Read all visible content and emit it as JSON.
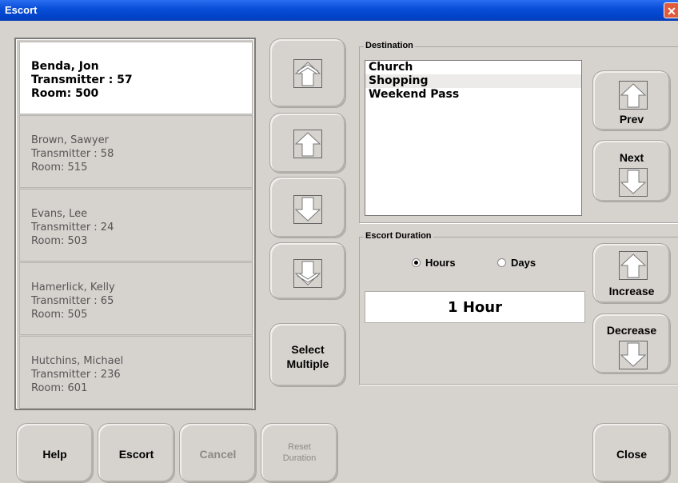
{
  "window": {
    "title": "Escort",
    "close_glyph": "✕"
  },
  "residents": [
    {
      "name": "Benda, Jon",
      "transmitter": "Transmitter : 57",
      "room": "Room: 500",
      "selected": true
    },
    {
      "name": "Brown, Sawyer",
      "transmitter": "Transmitter : 58",
      "room": "Room: 515",
      "selected": false
    },
    {
      "name": "Evans, Lee",
      "transmitter": "Transmitter : 24",
      "room": "Room: 503",
      "selected": false
    },
    {
      "name": "Hamerlick, Kelly",
      "transmitter": "Transmitter : 65",
      "room": "Room: 505",
      "selected": false
    },
    {
      "name": "Hutchins, Michael",
      "transmitter": "Transmitter : 236",
      "room": "Room: 601",
      "selected": false
    }
  ],
  "scroll": {
    "select_multiple_line1": "Select",
    "select_multiple_line2": "Multiple"
  },
  "destination": {
    "group_title": "Destination",
    "items": [
      "Church",
      "Shopping",
      "Weekend Pass"
    ],
    "highlighted_index": 1,
    "prev_label": "Prev",
    "next_label": "Next"
  },
  "escort_duration": {
    "group_title": "Escort Duration",
    "hours_label": "Hours",
    "days_label": "Days",
    "selected_unit": "Hours",
    "value": "1 Hour",
    "increase_label": "Increase",
    "decrease_label": "Decrease"
  },
  "footer": {
    "help_label": "Help",
    "escort_label": "Escort",
    "cancel_label": "Cancel",
    "reset_line1": "Reset",
    "reset_line2": "Duration",
    "close_label": "Close"
  },
  "colors": {
    "titlebar": "#0a4fd8",
    "window_bg": "#d6d3ce",
    "selected_bg": "#ffffff",
    "close_button": "#e05a3c"
  }
}
